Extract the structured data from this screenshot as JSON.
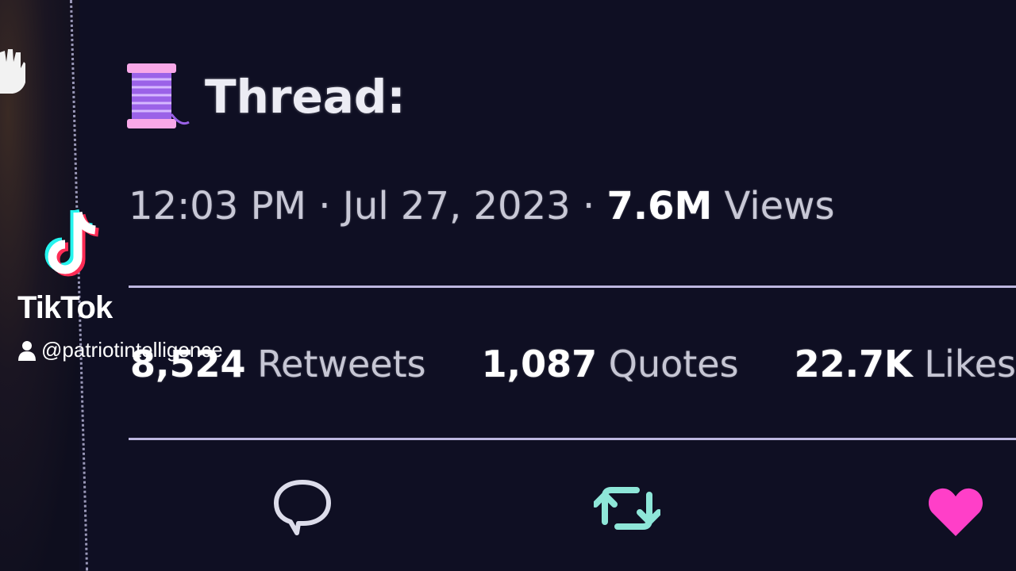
{
  "tweet": {
    "thread_label": "Thread:",
    "time": "12:03 PM",
    "date": "Jul 27, 2023",
    "views_count": "7.6M",
    "views_label": "Views",
    "separator": "·"
  },
  "stats": [
    {
      "count": "8,524",
      "label": "Retweets"
    },
    {
      "count": "1,087",
      "label": "Quotes"
    },
    {
      "count": "22.7K",
      "label": "Likes"
    }
  ],
  "actions": {
    "reply_icon": "speech-bubble",
    "retweet_icon": "retweet-arrows",
    "like_icon": "heart-filled"
  },
  "watermark": {
    "brand": "TikTok",
    "username": "@patriotintelligence"
  },
  "colors": {
    "background": "#0f0f23",
    "retweet": "#8ee6d8",
    "like": "#ff3fc8",
    "spool": "#9b62e8",
    "divider": "#bdb7e0"
  }
}
